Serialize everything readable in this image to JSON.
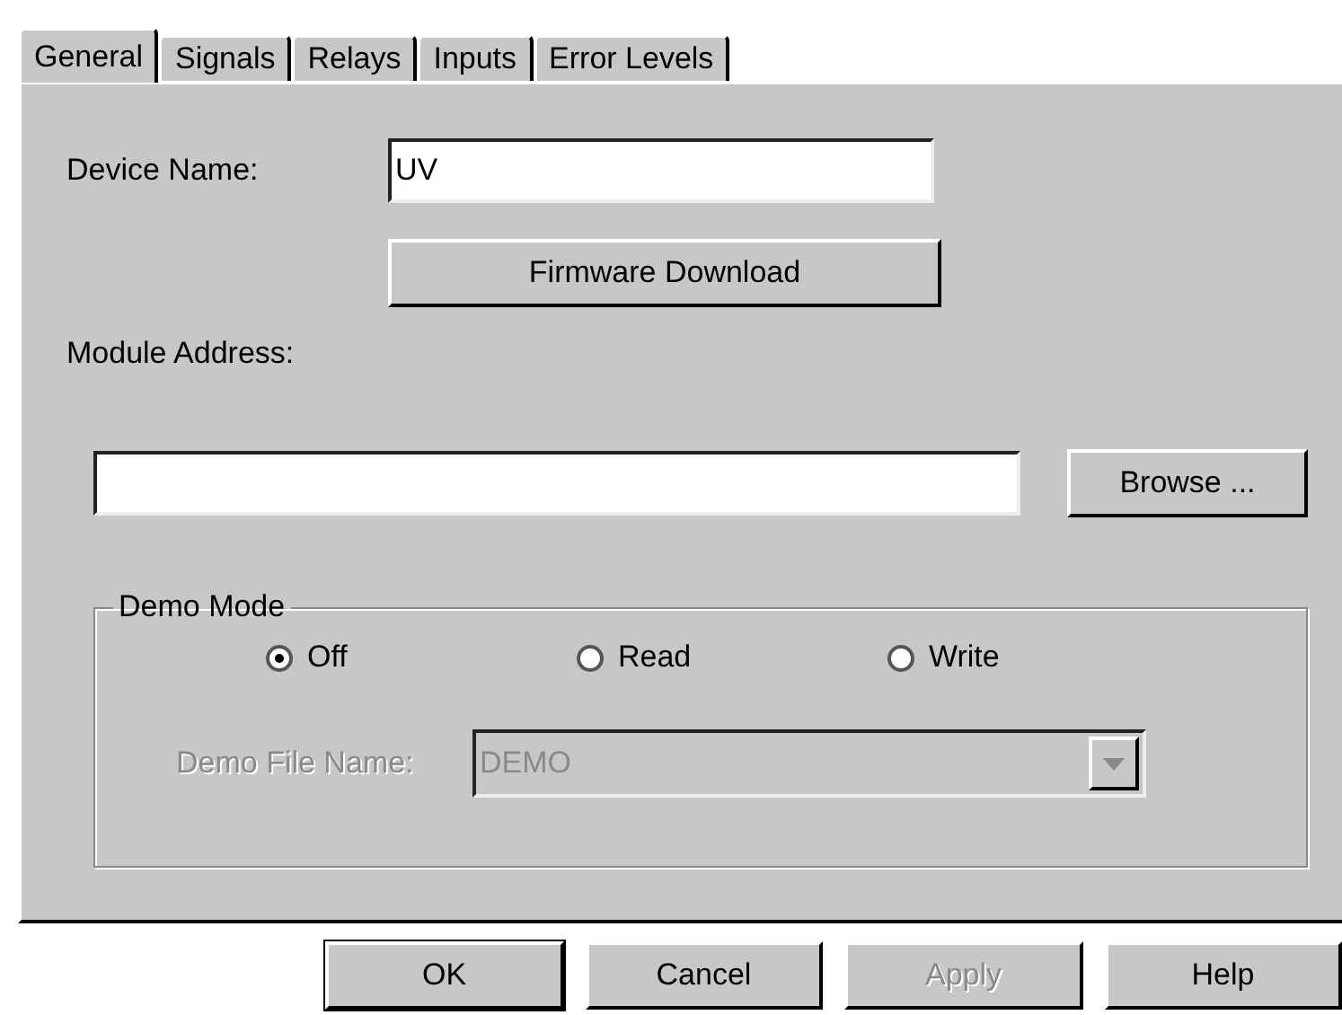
{
  "tabs": [
    {
      "label": "General",
      "selected": true
    },
    {
      "label": "Signals",
      "selected": false
    },
    {
      "label": "Relays",
      "selected": false
    },
    {
      "label": "Inputs",
      "selected": false
    },
    {
      "label": "Error Levels",
      "selected": false
    }
  ],
  "device_name": {
    "label": "Device Name:",
    "value": "UV"
  },
  "firmware_button": {
    "label": "Firmware Download"
  },
  "module_address": {
    "label": "Module Address:",
    "browse_button": "Browse ..."
  },
  "demo_mode": {
    "title": "Demo Mode",
    "options": [
      {
        "label": "Off",
        "selected": true
      },
      {
        "label": "Read",
        "selected": false
      },
      {
        "label": "Write",
        "selected": false
      }
    ],
    "file_name": {
      "label": "Demo File Name:",
      "value": "DEMO",
      "disabled": true
    }
  },
  "buttons": [
    {
      "label": "OK",
      "default": true,
      "disabled": false
    },
    {
      "label": "Cancel",
      "default": false,
      "disabled": false
    },
    {
      "label": "Apply",
      "default": false,
      "disabled": true
    },
    {
      "label": "Help",
      "default": false,
      "disabled": false
    }
  ]
}
